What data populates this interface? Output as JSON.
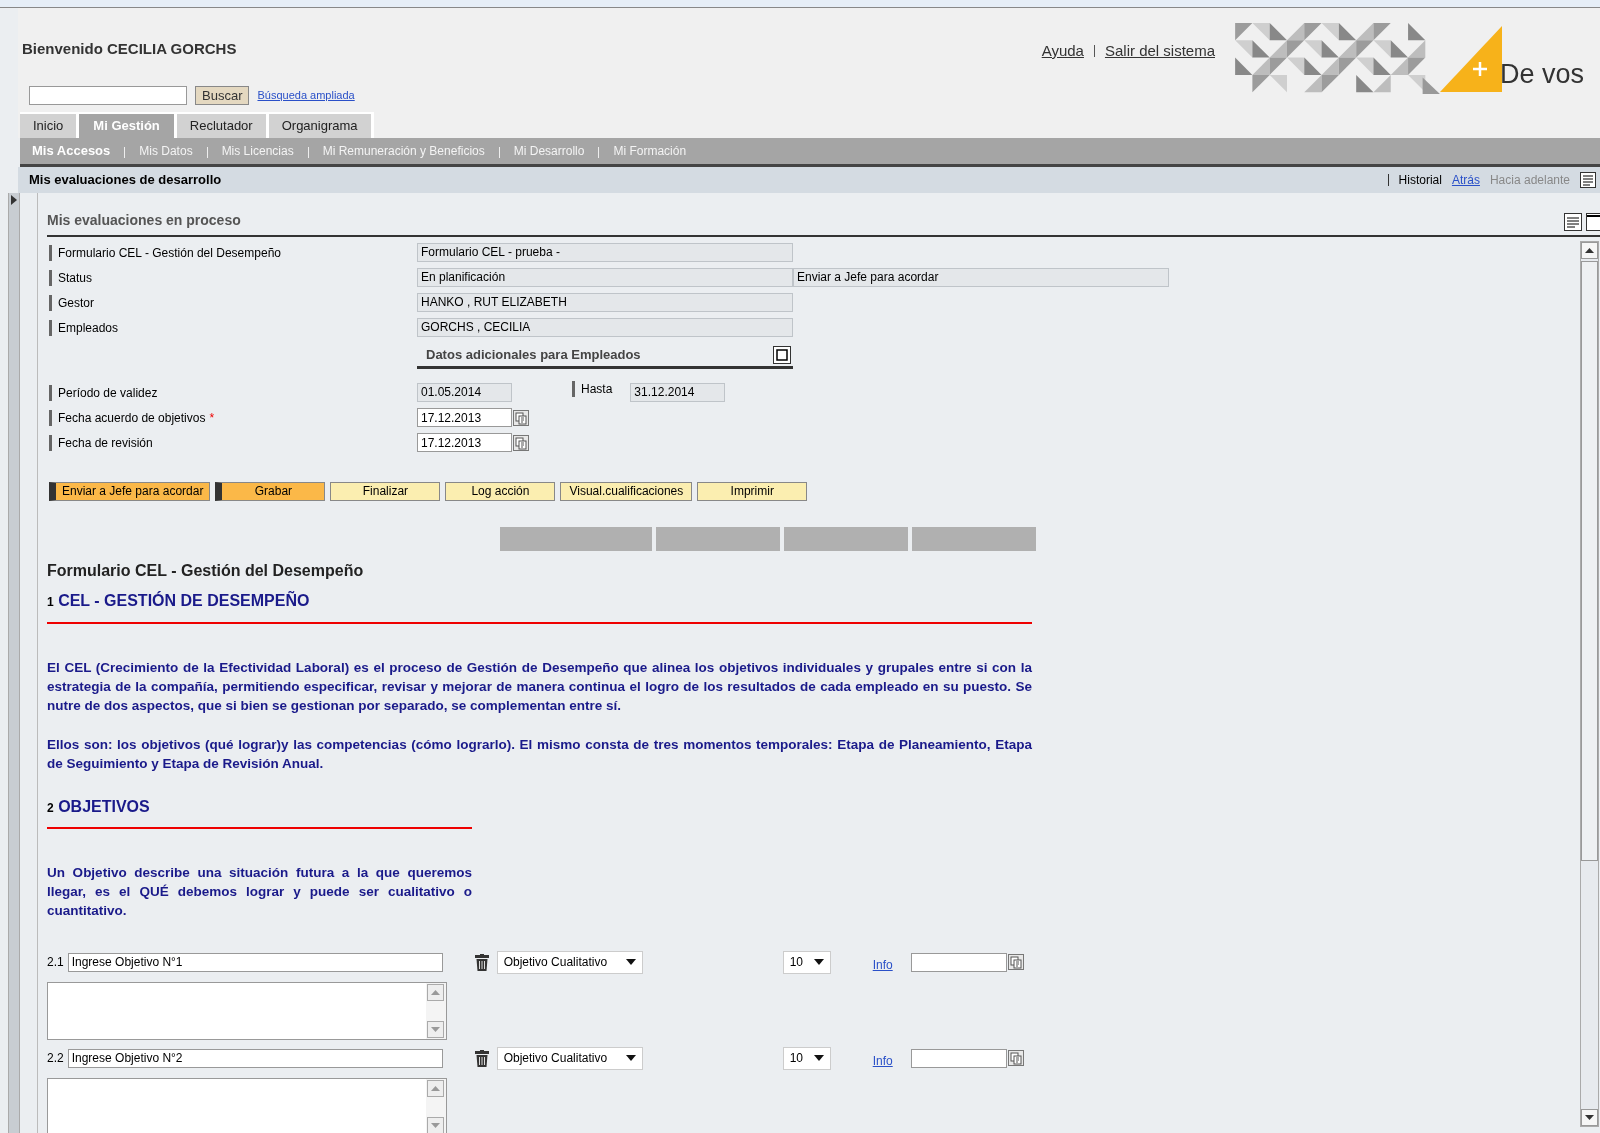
{
  "header": {
    "welcome": "Bienvenido CECILIA GORCHS",
    "links": [
      "Ayuda",
      "Salir del sistema"
    ],
    "logo_text": "De vos"
  },
  "search": {
    "button": "Buscar",
    "link": "Búsqueda ampliada"
  },
  "tabs": [
    {
      "label": "Inicio",
      "selected": false
    },
    {
      "label": "Mi Gestión",
      "selected": true
    },
    {
      "label": "Reclutador",
      "selected": false
    },
    {
      "label": "Organigrama",
      "selected": false
    }
  ],
  "subnav": [
    {
      "label": "Mis Accesos",
      "selected": true
    },
    {
      "label": "Mis Datos",
      "selected": false
    },
    {
      "label": "Mis Licencias",
      "selected": false
    },
    {
      "label": "Mi Remuneración y Beneficios",
      "selected": false
    },
    {
      "label": "Mi Desarrollo",
      "selected": false
    },
    {
      "label": "Mi Formación",
      "selected": false
    }
  ],
  "page_title": "Mis evaluaciones de desarrollo",
  "history": {
    "label": "Historial",
    "back": "Atrás",
    "forward": "Hacia adelante"
  },
  "panel_title": "Mis evaluaciones en proceso",
  "fields": [
    {
      "label": "Formulario CEL - Gestión del Desempeño",
      "value": "Formulario CEL - prueba -"
    },
    {
      "label": "Status",
      "value": "En planificación",
      "extra": "Enviar a Jefe para acordar"
    },
    {
      "label": "Gestor",
      "value": "HANKO , RUT ELIZABETH"
    },
    {
      "label": "Empleados",
      "value": "GORCHS , CECILIA"
    }
  ],
  "additional_section": "Datos adicionales para Empleados",
  "period": {
    "label": "Período de validez",
    "from": "01.05.2014",
    "to_label": "Hasta",
    "to": "31.12.2014"
  },
  "required_mark": "*",
  "dates": [
    {
      "label": "Fecha acuerdo de objetivos",
      "required": true,
      "value": "17.12.2013"
    },
    {
      "label": "Fecha de revisión",
      "required": false,
      "value": "17.12.2013"
    }
  ],
  "actions": [
    {
      "label": "Enviar a Jefe para acordar",
      "emphasized": true
    },
    {
      "label": "Grabar",
      "emphasized": true
    },
    {
      "label": "Finalizar",
      "emphasized": false
    },
    {
      "label": "Log acción",
      "emphasized": false
    },
    {
      "label": "Visual.cualificaciones",
      "emphasized": false
    },
    {
      "label": "Imprimir",
      "emphasized": false
    }
  ],
  "form": {
    "title": "Formulario CEL - Gestión del Desempeño",
    "sections": [
      {
        "kind": "intro",
        "number": "1",
        "title": "CEL - GESTIÓN DE DESEMPEÑO",
        "paragraphs": [
          "El CEL (Crecimiento de la Efectividad Laboral) es el proceso de Gestión de Desempeño que alinea los objetivos individuales y grupales entre si con la estrategia de la compañía, permitiendo especificar, revisar y mejorar de manera continua el logro de los resultados de cada empleado en su puesto. Se nutre de dos aspectos, que si bien se gestionan por separado, se complementan entre sí.",
          "Ellos son: los objetivos (qué lograr)y las competencias (cómo lograrlo). El mismo consta de tres momentos temporales: Etapa de Planeamiento, Etapa de Seguimiento y Etapa de Revisión Anual."
        ]
      },
      {
        "kind": "objectives",
        "number": "2",
        "title": "OBJETIVOS",
        "paragraphs": [
          "Un Objetivo describe una situación futura a la que queremos llegar, es el QUÉ debemos lograr y puede ser cualitativo o cuantitativo."
        ]
      }
    ]
  },
  "objectives": [
    {
      "number": "2.1",
      "value": "Ingrese Objetivo N°1",
      "type": "Objetivo Cualitativo",
      "weight": "10",
      "link": "Info"
    },
    {
      "number": "2.2",
      "value": "Ingrese Objetivo N°2",
      "type": "Objetivo Cualitativo",
      "weight": "10",
      "link": "Info"
    }
  ]
}
